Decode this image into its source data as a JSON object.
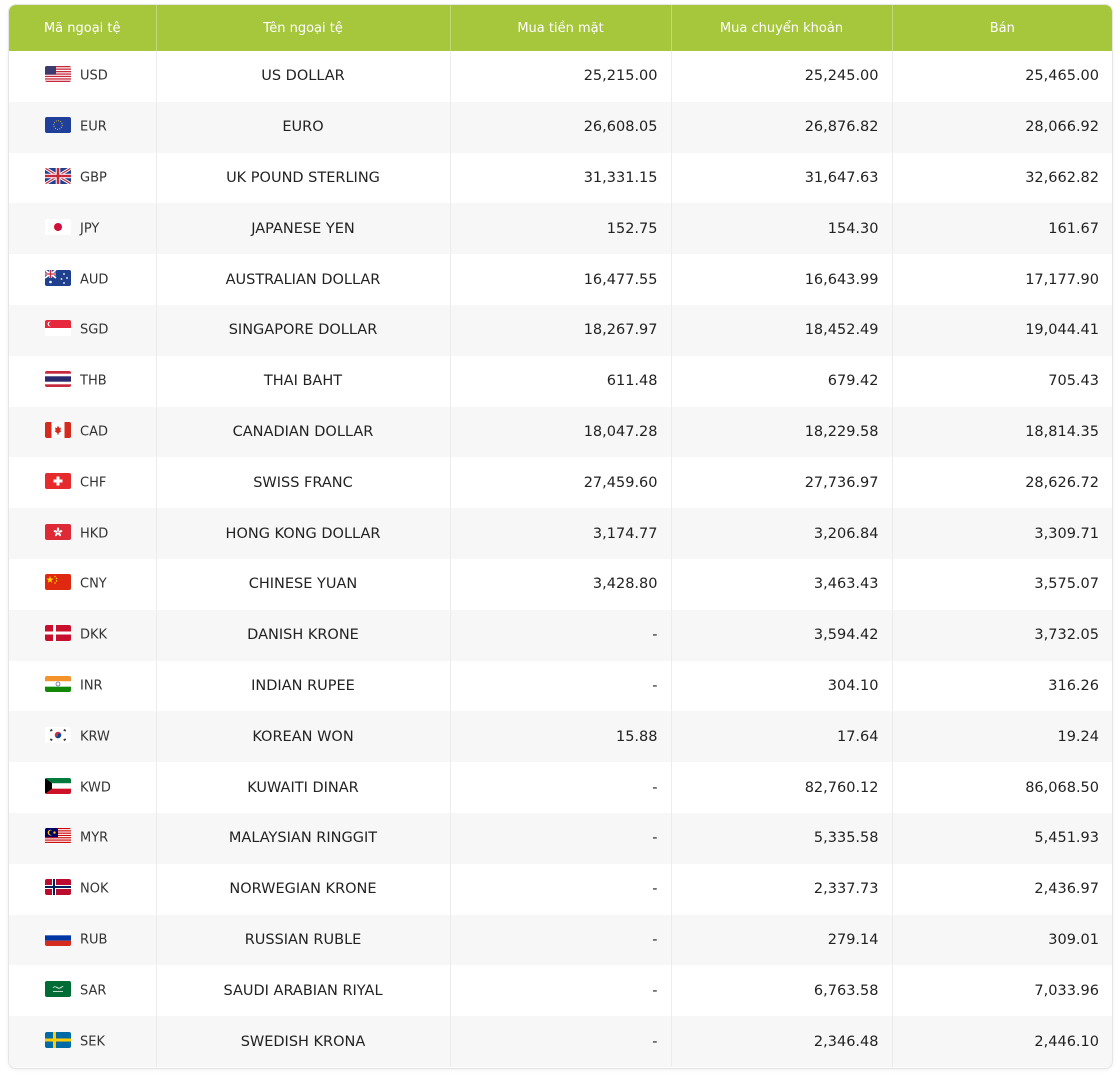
{
  "headers": [
    "Mã ngoại tệ",
    "Tên ngoại tệ",
    "Mua tiền mặt",
    "Mua chuyển khoản",
    "Bán"
  ],
  "colors": {
    "header_bg": "#a6c63c",
    "header_text": "#ffffff",
    "row_alt": "#f7f7f7"
  },
  "rows": [
    {
      "flag": "us-flag-icon",
      "code": "USD",
      "name": "US DOLLAR",
      "cash": "25,215.00",
      "transfer": "25,245.00",
      "sell": "25,465.00"
    },
    {
      "flag": "eu-flag-icon",
      "code": "EUR",
      "name": "EURO",
      "cash": "26,608.05",
      "transfer": "26,876.82",
      "sell": "28,066.92"
    },
    {
      "flag": "gb-flag-icon",
      "code": "GBP",
      "name": "UK POUND STERLING",
      "cash": "31,331.15",
      "transfer": "31,647.63",
      "sell": "32,662.82"
    },
    {
      "flag": "jp-flag-icon",
      "code": "JPY",
      "name": "JAPANESE YEN",
      "cash": "152.75",
      "transfer": "154.30",
      "sell": "161.67"
    },
    {
      "flag": "au-flag-icon",
      "code": "AUD",
      "name": "AUSTRALIAN DOLLAR",
      "cash": "16,477.55",
      "transfer": "16,643.99",
      "sell": "17,177.90"
    },
    {
      "flag": "sg-flag-icon",
      "code": "SGD",
      "name": "SINGAPORE DOLLAR",
      "cash": "18,267.97",
      "transfer": "18,452.49",
      "sell": "19,044.41"
    },
    {
      "flag": "th-flag-icon",
      "code": "THB",
      "name": "THAI BAHT",
      "cash": "611.48",
      "transfer": "679.42",
      "sell": "705.43"
    },
    {
      "flag": "ca-flag-icon",
      "code": "CAD",
      "name": "CANADIAN DOLLAR",
      "cash": "18,047.28",
      "transfer": "18,229.58",
      "sell": "18,814.35"
    },
    {
      "flag": "ch-flag-icon",
      "code": "CHF",
      "name": "SWISS FRANC",
      "cash": "27,459.60",
      "transfer": "27,736.97",
      "sell": "28,626.72"
    },
    {
      "flag": "hk-flag-icon",
      "code": "HKD",
      "name": "HONG KONG DOLLAR",
      "cash": "3,174.77",
      "transfer": "3,206.84",
      "sell": "3,309.71"
    },
    {
      "flag": "cn-flag-icon",
      "code": "CNY",
      "name": "CHINESE YUAN",
      "cash": "3,428.80",
      "transfer": "3,463.43",
      "sell": "3,575.07"
    },
    {
      "flag": "dk-flag-icon",
      "code": "DKK",
      "name": "DANISH KRONE",
      "cash": "-",
      "transfer": "3,594.42",
      "sell": "3,732.05"
    },
    {
      "flag": "in-flag-icon",
      "code": "INR",
      "name": "INDIAN RUPEE",
      "cash": "-",
      "transfer": "304.10",
      "sell": "316.26"
    },
    {
      "flag": "kr-flag-icon",
      "code": "KRW",
      "name": "KOREAN WON",
      "cash": "15.88",
      "transfer": "17.64",
      "sell": "19.24"
    },
    {
      "flag": "kw-flag-icon",
      "code": "KWD",
      "name": "KUWAITI DINAR",
      "cash": "-",
      "transfer": "82,760.12",
      "sell": "86,068.50"
    },
    {
      "flag": "my-flag-icon",
      "code": "MYR",
      "name": "MALAYSIAN RINGGIT",
      "cash": "-",
      "transfer": "5,335.58",
      "sell": "5,451.93"
    },
    {
      "flag": "no-flag-icon",
      "code": "NOK",
      "name": "NORWEGIAN KRONE",
      "cash": "-",
      "transfer": "2,337.73",
      "sell": "2,436.97"
    },
    {
      "flag": "ru-flag-icon",
      "code": "RUB",
      "name": "RUSSIAN RUBLE",
      "cash": "-",
      "transfer": "279.14",
      "sell": "309.01"
    },
    {
      "flag": "sa-flag-icon",
      "code": "SAR",
      "name": "SAUDI ARABIAN RIYAL",
      "cash": "-",
      "transfer": "6,763.58",
      "sell": "7,033.96"
    },
    {
      "flag": "se-flag-icon",
      "code": "SEK",
      "name": "SWEDISH KRONA",
      "cash": "-",
      "transfer": "2,346.48",
      "sell": "2,446.10"
    }
  ]
}
